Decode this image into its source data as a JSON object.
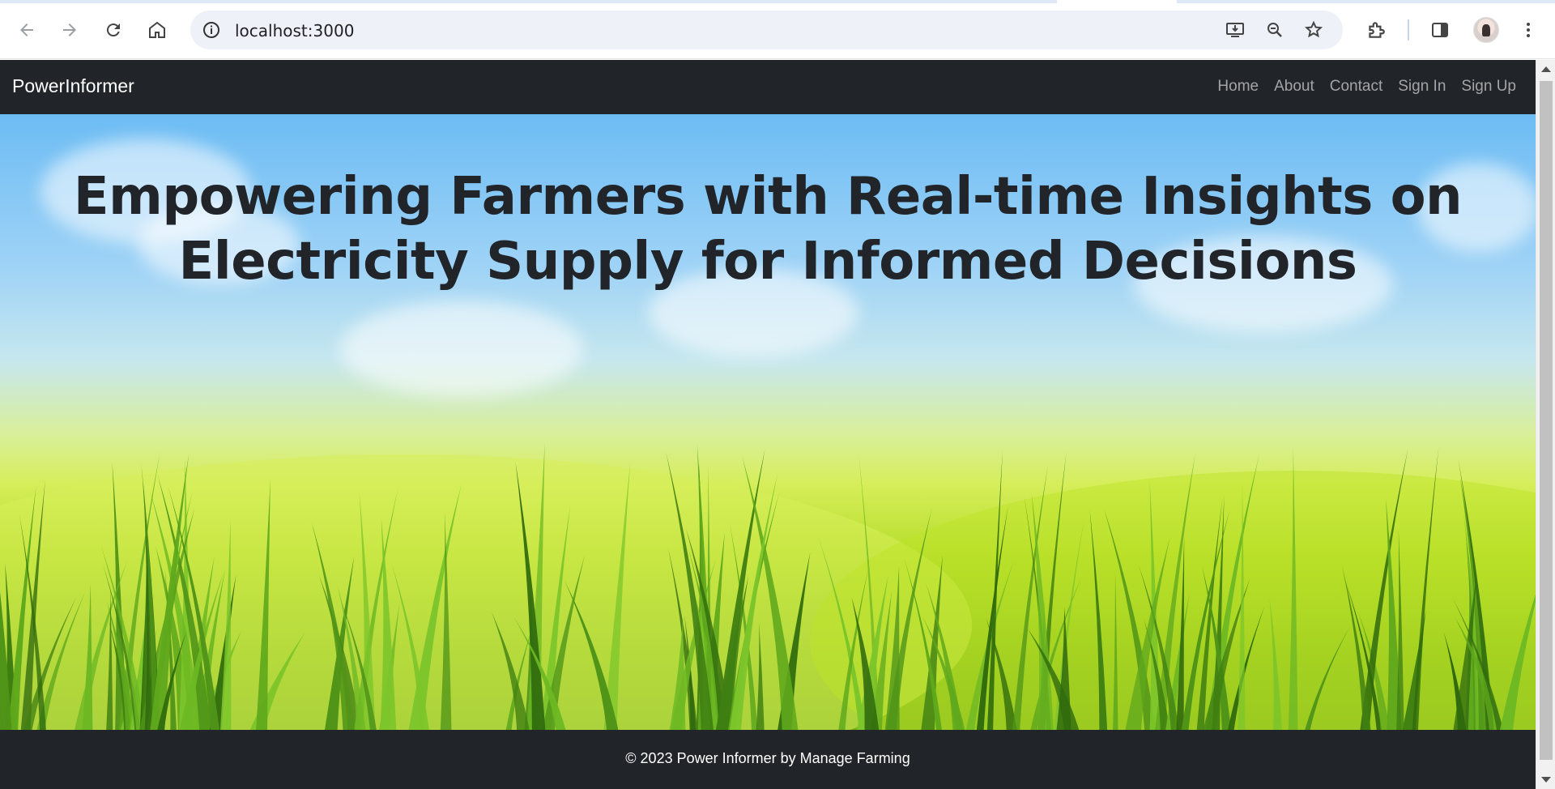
{
  "browser": {
    "url": "localhost:3000",
    "icons": [
      "back-icon",
      "forward-icon",
      "reload-icon",
      "home-icon",
      "info-icon",
      "install-icon",
      "zoom-icon",
      "bookmark-star-icon",
      "extensions-icon",
      "side-panel-icon",
      "menu-icon"
    ]
  },
  "navbar": {
    "brand": "PowerInformer",
    "links": [
      "Home",
      "About",
      "Contact",
      "Sign In",
      "Sign Up"
    ]
  },
  "hero": {
    "title": "Empowering Farmers with Real-time Insights on Electricity Supply for Informed Decisions"
  },
  "footer": {
    "text": "© 2023 Power Informer by Manage Farming"
  },
  "colors": {
    "navbar_bg": "#212529",
    "nav_link": "rgba(255,255,255,0.58)",
    "title_text": "#212529"
  }
}
